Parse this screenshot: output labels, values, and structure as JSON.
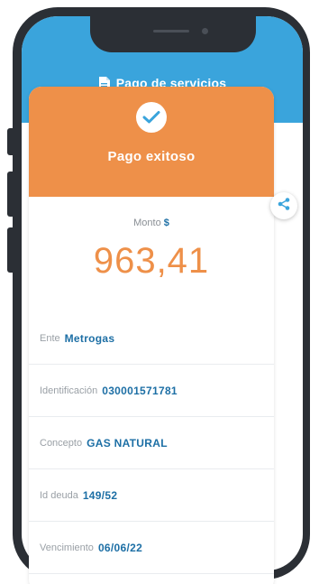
{
  "header": {
    "title": "Pago de servicios",
    "icon": "document-icon"
  },
  "status": {
    "title": "Pago exitoso",
    "icon": "check-icon"
  },
  "amount": {
    "label": "Monto",
    "currency": "$",
    "value": "963,41"
  },
  "details": [
    {
      "label": "Ente",
      "value": "Metrogas"
    },
    {
      "label": "Identificación",
      "value": "030001571781"
    },
    {
      "label": "Concepto",
      "value": "GAS NATURAL"
    },
    {
      "label": "Id deuda",
      "value": "149/52"
    },
    {
      "label": "Vencimiento",
      "value": "06/06/22"
    }
  ],
  "colors": {
    "primary": "#3aa4dc",
    "accent": "#ee9049",
    "value_text": "#1d6fa5"
  },
  "actions": {
    "share_icon": "share-icon"
  }
}
